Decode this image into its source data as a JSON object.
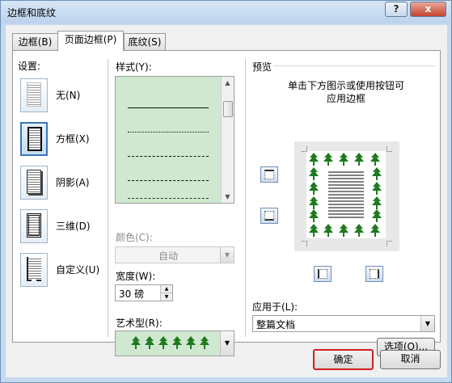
{
  "window": {
    "title": "边框和底纹",
    "help": "?",
    "close": "x"
  },
  "tabs": [
    {
      "label": "边框(B)"
    },
    {
      "label": "页面边框(P)"
    },
    {
      "label": "底纹(S)"
    }
  ],
  "settings": {
    "label": "设置:",
    "items": [
      {
        "label": "无(N)"
      },
      {
        "label": "方框(X)"
      },
      {
        "label": "阴影(A)"
      },
      {
        "label": "三维(D)"
      },
      {
        "label": "自定义(U)"
      }
    ]
  },
  "style": {
    "label": "样式(Y):"
  },
  "color": {
    "label": "颜色(C):",
    "value": "自动"
  },
  "width": {
    "label": "宽度(W):",
    "value": "30 磅"
  },
  "art": {
    "label": "艺术型(R):"
  },
  "preview": {
    "label": "预览",
    "hint_line1": "单击下方图示或使用按钮可",
    "hint_line2": "应用边框"
  },
  "apply_to": {
    "label": "应用于(L):",
    "value": "整篇文档"
  },
  "options_button": "选项(O)...",
  "ok_button": "确定",
  "cancel_button": "取消",
  "colors": {
    "tree": "#1f7a1f",
    "list_bg": "#cfe8cf",
    "ok_outline": "#d02020"
  }
}
